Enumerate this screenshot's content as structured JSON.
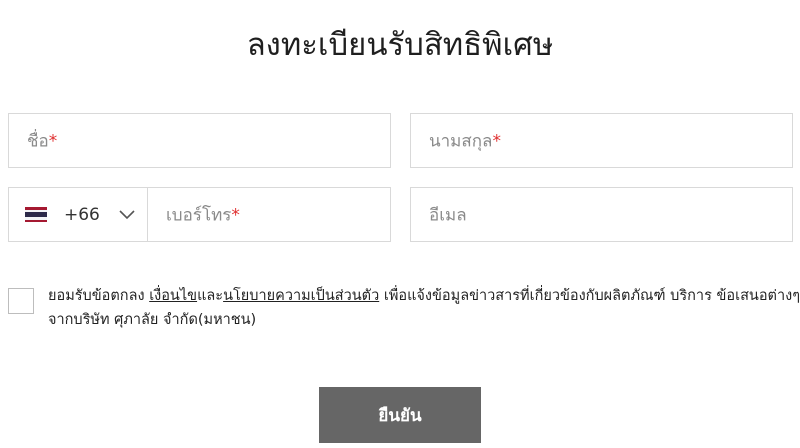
{
  "form": {
    "title": "ลงทะเบียนรับสิทธิพิเศษ",
    "first_name": {
      "placeholder": "ชื่อ",
      "required_mark": "*",
      "value": ""
    },
    "last_name": {
      "placeholder": "นามสกุล",
      "required_mark": "*",
      "value": ""
    },
    "phone": {
      "country_flag": "thailand-flag-icon",
      "dial_code": "+66",
      "placeholder": "เบอร์โทร",
      "required_mark": "*",
      "value": ""
    },
    "email": {
      "placeholder": "อีเมล",
      "value": ""
    },
    "consent": {
      "checked": false,
      "text_before": "ยอมรับข้อตกลง ",
      "link_terms": "เงื่อนไข",
      "text_and": "และ",
      "link_privacy": "นโยบายความเป็นส่วนตัว",
      "text_after": " เพื่อแจ้งข้อมูลข่าวสารที่เกี่ยวข้องกับผลิตภัณฑ์ บริการ ข้อเสนอต่างๆ จากบริษัท ศุภาลัย จำกัด(มหาชน)"
    },
    "submit_label": "ยืนยัน"
  },
  "colors": {
    "button_bg": "#666666",
    "required": "#e03131",
    "border": "#d9d9d9",
    "flag_red": "#a51931",
    "flag_white": "#f4f5f8",
    "flag_blue": "#2d2a4a"
  }
}
